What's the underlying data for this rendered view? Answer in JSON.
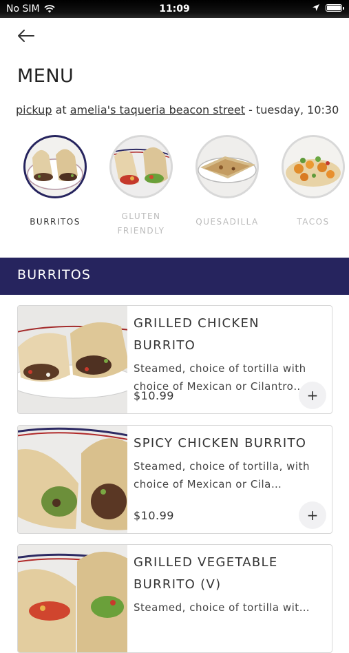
{
  "status_bar": {
    "carrier": "No SIM",
    "time": "11:09"
  },
  "header": {
    "title": "MENU"
  },
  "order_info": {
    "mode": "pickup",
    "at": "at",
    "location": "amelia's taqueria beacon street",
    "time": "- tuesday, 10:30"
  },
  "categories": [
    {
      "label": "BURRITOS",
      "active": true
    },
    {
      "label": "GLUTEN FRIENDLY",
      "active": false
    },
    {
      "label": "QUESADILLA",
      "active": false
    },
    {
      "label": "TACOS",
      "active": false
    }
  ],
  "section": {
    "title": "BURRITOS"
  },
  "items": [
    {
      "name": "GRILLED CHICKEN BURRITO",
      "description": "Steamed, choice of tortilla with choice of Mexican or Cilantro…",
      "price": "$10.99",
      "add_label": "+"
    },
    {
      "name": "SPICY CHICKEN BURRITO",
      "description": "Steamed, choice of tortilla, with choice of Mexican or Cila…",
      "price": "$10.99",
      "add_label": "+"
    },
    {
      "name": "GRILLED VEGETABLE BURRITO (V)",
      "description": "Steamed, choice of tortilla wit…",
      "price": "",
      "add_label": ""
    }
  ],
  "colors": {
    "accent": "#26245e",
    "inactive_label": "#bbbbbb",
    "add_button_bg": "#f1f1f3"
  },
  "icons": [
    "wifi-icon",
    "location-arrow-icon",
    "battery-icon",
    "back-arrow-icon",
    "plus-icon"
  ]
}
